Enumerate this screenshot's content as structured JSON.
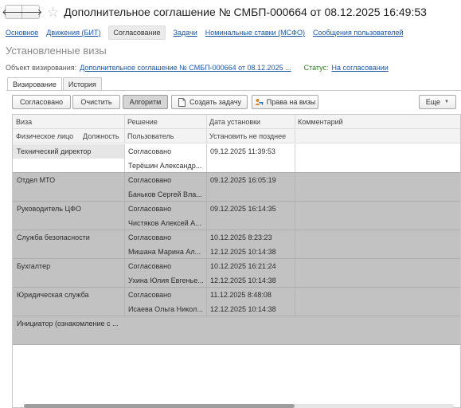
{
  "window": {
    "title": "Дополнительное соглашение № СМБП-000664 от 08.12.2025 16:49:53",
    "back_icon": "arrow-left-icon",
    "forward_icon": "arrow-right-icon",
    "favorite_icon": "star-icon"
  },
  "sections": {
    "main": "Основное",
    "movements": "Движения (БИТ)",
    "approval": "Согласование",
    "tasks": "Задачи",
    "rates": "Номинальные ставки (МСФО)",
    "messages": "Сообщения пользователей"
  },
  "subheading": "Установленные визы",
  "object": {
    "label": "Объект визирования:",
    "value": "Дополнительное соглашение № СМБП-000664 от 08.12.2025 ...",
    "status_label": "Статус:",
    "status_value": "На согласовании"
  },
  "tabs": {
    "approvals": "Визирование",
    "history": "История"
  },
  "toolbar": {
    "approved": "Согласовано",
    "clear": "Очистить",
    "algorithm": "Алгоритм",
    "create_task": "Создать задачу",
    "visa_rights": "Права на визы",
    "more": "Еще",
    "more_icon": "caret-down-icon",
    "create_task_icon": "document-icon",
    "visa_rights_icon": "users-key-icon"
  },
  "table": {
    "headers": {
      "visa": "Виза",
      "decision": "Решение",
      "date": "Дата установки",
      "comment": "Комментарий",
      "person": "Физическое лицо",
      "position": "Должность",
      "user": "Пользователь",
      "deadline": "Установить не позднее"
    },
    "rows": [
      {
        "role": "Технический директор",
        "decision": "Согласовано",
        "date": "09.12.2025 11:39:53",
        "user": "Терёшин Александр...",
        "deadline": ""
      },
      {
        "role": "Отдел МТО",
        "decision": "Согласовано",
        "date": "09.12.2025 16:05:19",
        "user": "Баньков Сергей Вла...",
        "deadline": ""
      },
      {
        "role": "Руководитель ЦФО",
        "decision": "Согласовано",
        "date": "09.12.2025 16:14:35",
        "user": "Чистяков Алексей А...",
        "deadline": ""
      },
      {
        "role": "Служба безопасности",
        "decision": "Согласовано",
        "date": "10.12.2025 8:23:23",
        "user": "Мишана Марина Ал...",
        "deadline": "12.12.2025 10:14:38"
      },
      {
        "role": "Бухгалтер",
        "decision": "Согласовано",
        "date": "10.12.2025 16:21:24",
        "user": "Ухина Юлия Евгенье...",
        "deadline": "12.12.2025 10:14:38"
      },
      {
        "role": "Юридическая служба",
        "decision": "Согласовано",
        "date": "11.12.2025 8:48:08",
        "user": "Исаева Ольга Никол...",
        "deadline": "12.12.2025 10:14:38"
      },
      {
        "role": "Инициатор (ознакомление с ...",
        "decision": "",
        "date": "",
        "user": "",
        "deadline": ""
      }
    ]
  }
}
